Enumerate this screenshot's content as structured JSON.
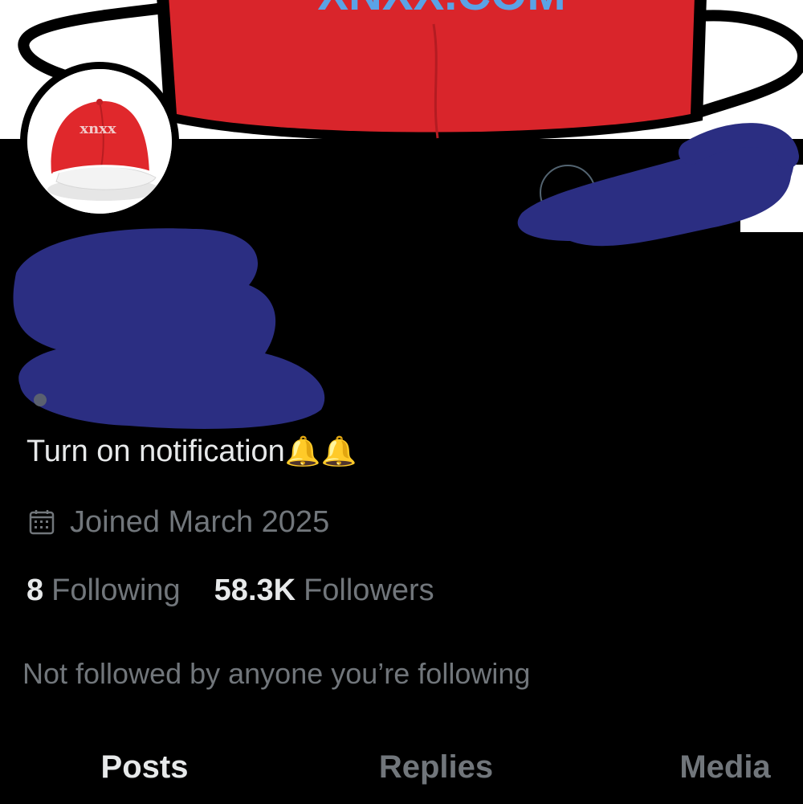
{
  "header": {
    "banner_text": "XNXX.COM",
    "banner_color": "#d9252b",
    "banner_text_color": "#5aa3e6"
  },
  "avatar": {
    "cap_text": "xnxx",
    "cap_color": "#e0282c"
  },
  "profile": {
    "bio": "Turn on notification",
    "bio_emoji": "🔔🔔",
    "joined_text": "Joined March 2025",
    "following_count": "8",
    "following_label": "Following",
    "followers_count": "58.3K",
    "followers_label": "Followers",
    "not_followed_text": "Not followed by anyone you’re following"
  },
  "tabs": [
    {
      "label": "Posts",
      "active": true
    },
    {
      "label": "Replies",
      "active": false
    },
    {
      "label": "Media",
      "active": false
    }
  ],
  "colors": {
    "background": "#000000",
    "primary_text": "#e7e9ea",
    "secondary_text": "#71767b",
    "redaction": "#2b2e82"
  }
}
